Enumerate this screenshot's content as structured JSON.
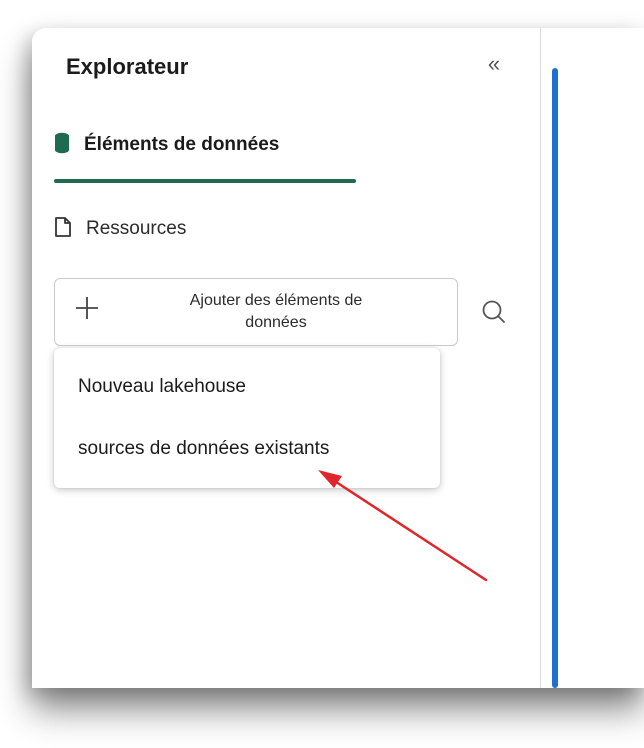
{
  "sidebar": {
    "title": "Explorateur",
    "collapse_glyph": "«",
    "tabs": [
      {
        "label": "Éléments de données",
        "icon": "database-icon",
        "active": true,
        "icon_color": "#1e6b4f"
      },
      {
        "label": "Ressources",
        "icon": "document-icon",
        "active": false
      }
    ],
    "add_button": {
      "line1": "Ajouter des éléments de",
      "line2": "données",
      "icon": "plus-icon"
    },
    "search_icon": "search-icon"
  },
  "dropdown": {
    "items": [
      {
        "label": "Nouveau lakehouse"
      },
      {
        "label": "sources de données existants"
      }
    ]
  },
  "annotation": {
    "arrow_color": "#e0262b"
  },
  "colors": {
    "accent_green": "#1e6b4f",
    "scrollbar_blue": "#1f6fd1"
  }
}
